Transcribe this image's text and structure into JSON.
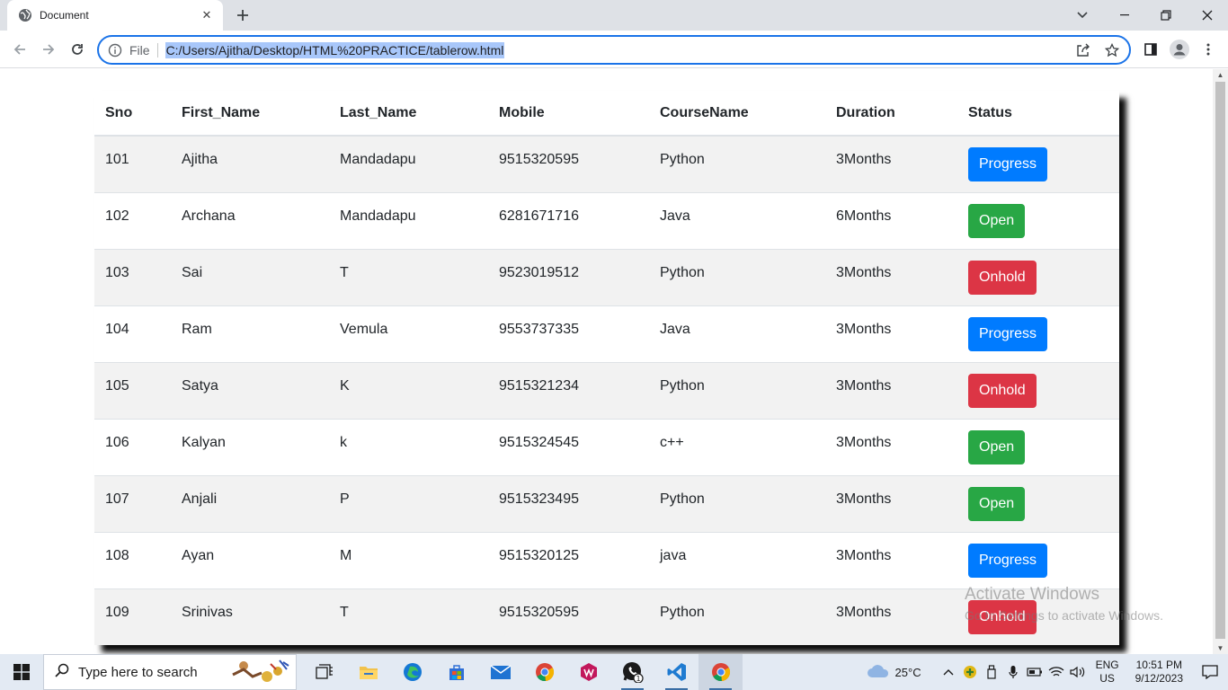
{
  "browser": {
    "tab_title": "Document",
    "tab_icon": "globe-icon",
    "scheme_label": "File",
    "url": "C:/Users/Ajitha/Desktop/HTML%20PRACTICE/tablerow.html",
    "accent_color": "#1a73e8"
  },
  "table": {
    "headers": [
      "Sno",
      "First_Name",
      "Last_Name",
      "Mobile",
      "CourseName",
      "Duration",
      "Status"
    ],
    "rows": [
      {
        "sno": "101",
        "first": "Ajitha",
        "last": "Mandadapu",
        "mobile": "9515320595",
        "course": "Python",
        "duration": "3Months",
        "status": "Progress",
        "status_type": "progress"
      },
      {
        "sno": "102",
        "first": "Archana",
        "last": "Mandadapu",
        "mobile": "6281671716",
        "course": "Java",
        "duration": "6Months",
        "status": "Open",
        "status_type": "open"
      },
      {
        "sno": "103",
        "first": "Sai",
        "last": "T",
        "mobile": "9523019512",
        "course": "Python",
        "duration": "3Months",
        "status": "Onhold",
        "status_type": "onhold"
      },
      {
        "sno": "104",
        "first": "Ram",
        "last": "Vemula",
        "mobile": "9553737335",
        "course": "Java",
        "duration": "3Months",
        "status": "Progress",
        "status_type": "progress"
      },
      {
        "sno": "105",
        "first": "Satya",
        "last": "K",
        "mobile": "9515321234",
        "course": "Python",
        "duration": "3Months",
        "status": "Onhold",
        "status_type": "onhold"
      },
      {
        "sno": "106",
        "first": "Kalyan",
        "last": "k",
        "mobile": "9515324545",
        "course": "c++",
        "duration": "3Months",
        "status": "Open",
        "status_type": "open"
      },
      {
        "sno": "107",
        "first": "Anjali",
        "last": "P",
        "mobile": "9515323495",
        "course": "Python",
        "duration": "3Months",
        "status": "Open",
        "status_type": "open"
      },
      {
        "sno": "108",
        "first": "Ayan",
        "last": "M",
        "mobile": "9515320125",
        "course": "java",
        "duration": "3Months",
        "status": "Progress",
        "status_type": "progress"
      },
      {
        "sno": "109",
        "first": "Srinivas",
        "last": "T",
        "mobile": "9515320595",
        "course": "Python",
        "duration": "3Months",
        "status": "Onhold",
        "status_type": "onhold"
      }
    ],
    "status_colors": {
      "progress": "#007bff",
      "open": "#28a745",
      "onhold": "#dc3545"
    }
  },
  "watermark": {
    "line1": "Activate Windows",
    "line2": "Go to Settings to activate Windows."
  },
  "taskbar": {
    "search_placeholder": "Type here to search",
    "apps": [
      "task-view-icon",
      "file-explorer-icon",
      "edge-icon",
      "store-icon",
      "mail-icon",
      "chrome-icon",
      "winzip-icon",
      "whatsapp-icon",
      "vscode-icon",
      "chrome-icon"
    ],
    "whatsapp_badge": "1",
    "weather_temp": "25°C",
    "lang_line1": "ENG",
    "lang_line2": "US",
    "time": "10:51 PM",
    "date": "9/12/2023"
  }
}
